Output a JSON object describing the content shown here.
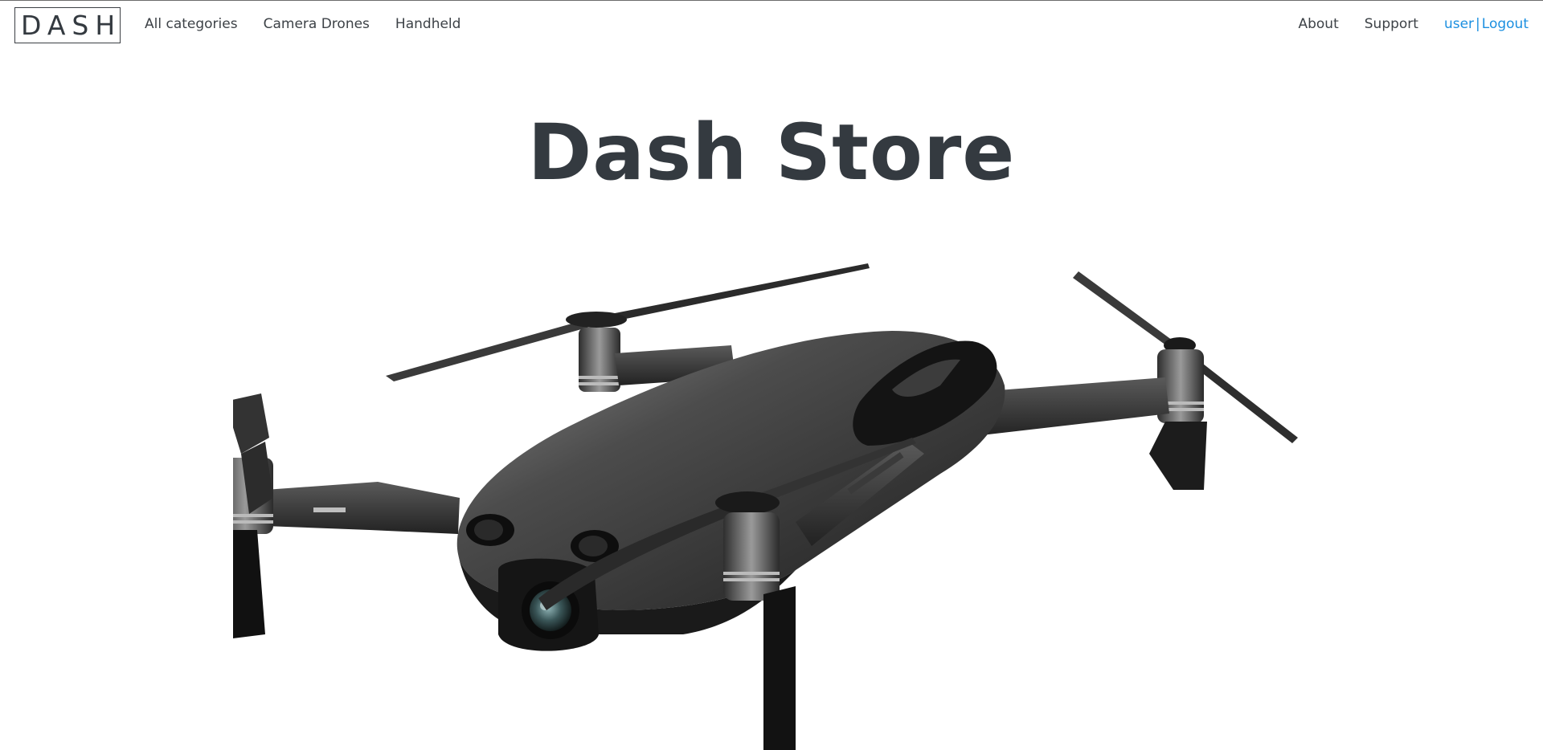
{
  "navbar": {
    "brand": "DASH",
    "links": [
      "All categories",
      "Camera Drones",
      "Handheld"
    ],
    "right_links": [
      "About",
      "Support"
    ],
    "user": "user",
    "separator": "|",
    "logout": "Logout",
    "accent_color": "#1b8fe0"
  },
  "hero": {
    "title": "Dash Store",
    "image_icon": "camera-drone-image"
  }
}
